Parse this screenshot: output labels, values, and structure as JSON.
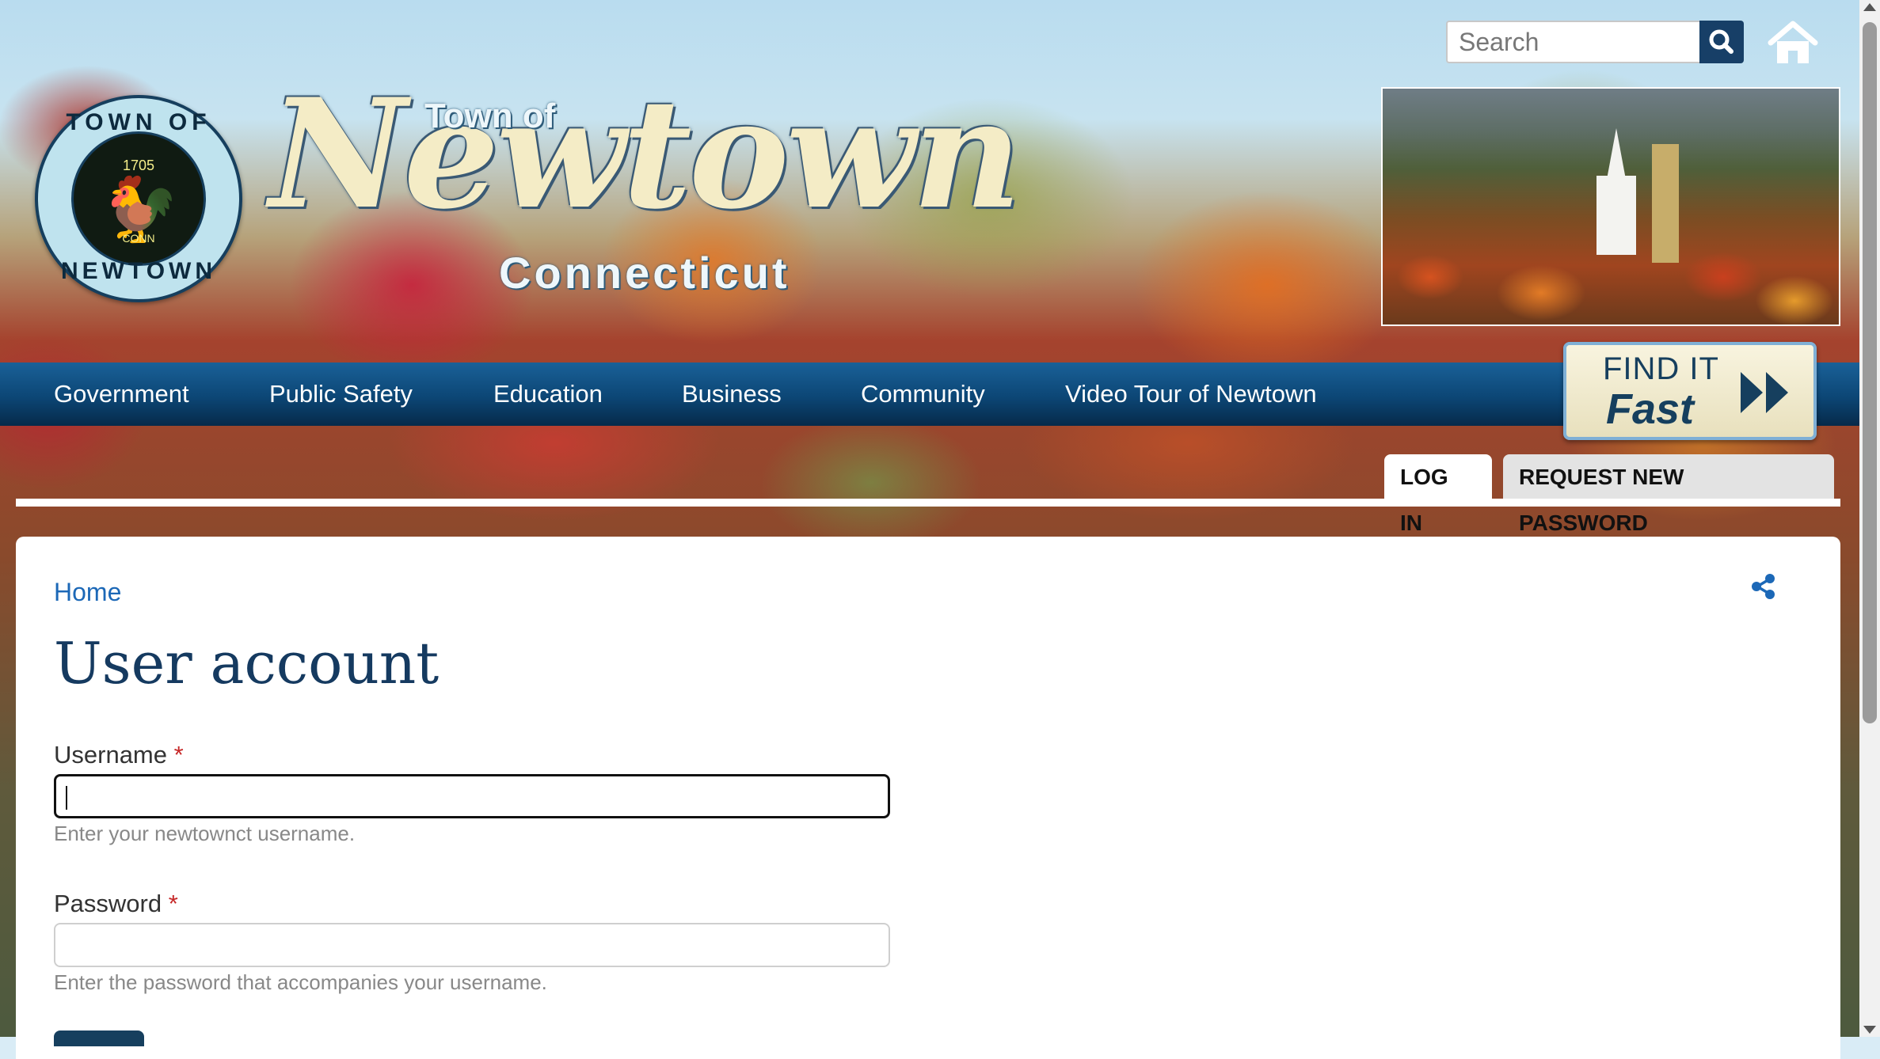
{
  "header": {
    "seal": {
      "top_text": "TOWN OF",
      "bottom_text": "NEWTOWN",
      "year": "1705",
      "small_text": "CONN"
    },
    "logo": {
      "line1": "Town of",
      "line2": "Newtown",
      "line3": "Connecticut"
    },
    "search": {
      "placeholder": "Search",
      "value": "",
      "icon": "search-icon"
    },
    "home_icon": "home-icon"
  },
  "nav": {
    "items": [
      {
        "label": "Government"
      },
      {
        "label": "Public Safety"
      },
      {
        "label": "Education"
      },
      {
        "label": "Business"
      },
      {
        "label": "Community"
      },
      {
        "label": "Video Tour of Newtown"
      }
    ],
    "find_it_fast": {
      "line1": "FIND IT",
      "line2": "Fast"
    }
  },
  "tabs": [
    {
      "label": "LOG IN",
      "active": true
    },
    {
      "label": "REQUEST NEW PASSWORD",
      "active": false
    }
  ],
  "content": {
    "breadcrumb": "Home",
    "share_icon": "share-icon",
    "title": "User account",
    "username": {
      "label": "Username",
      "required_marker": "*",
      "value": "",
      "description": "Enter your newtownct username."
    },
    "password": {
      "label": "Password",
      "required_marker": "*",
      "value": "",
      "description": "Enter the password that accompanies your username."
    }
  },
  "colors": {
    "nav_blue": "#0c4675",
    "title_blue": "#153a60",
    "link_blue": "#1c68b7",
    "required_red": "#c62828"
  }
}
